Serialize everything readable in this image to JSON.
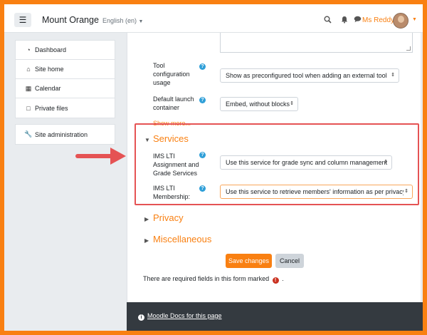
{
  "navbar": {
    "site_name": "Mount Orange",
    "language": "English (en)",
    "user_name": "Ms Reddy",
    "icons": [
      "menu-icon",
      "search-icon",
      "bell-icon",
      "chat-icon",
      "chevron-down-icon"
    ]
  },
  "sidebar": {
    "items": [
      {
        "label": "Dashboard",
        "icon": "dashboard-icon"
      },
      {
        "label": "Site home",
        "icon": "home-icon"
      },
      {
        "label": "Calendar",
        "icon": "calendar-icon"
      },
      {
        "label": "Private files",
        "icon": "file-icon"
      }
    ],
    "admin": {
      "label": "Site administration",
      "icon": "wrench-icon"
    }
  },
  "form": {
    "tool_config_usage": {
      "label": "Tool configuration usage",
      "value": "Show as preconfigured tool when adding an external tool"
    },
    "default_launch_container": {
      "label": "Default launch container",
      "value": "Embed, without blocks"
    },
    "show_more": "Show more...",
    "services": {
      "title": "Services",
      "ags": {
        "label": "IMS LTI Assignment and Grade Services",
        "value": "Use this service for grade sync and column management"
      },
      "membership": {
        "label": "IMS LTI Membership:",
        "value": "Use this service to retrieve members' information as per privacy s"
      }
    },
    "privacy_title": "Privacy",
    "misc_title": "Miscellaneous",
    "save_label": "Save changes",
    "cancel_label": "Cancel",
    "required_note_before": "There are required fields in this form marked",
    "required_note_after": "."
  },
  "footer": {
    "docs_link": "Moodle Docs for this page"
  },
  "colors": {
    "accent": "#f98012",
    "highlight": "#e55354",
    "help": "#2f9fd8"
  }
}
